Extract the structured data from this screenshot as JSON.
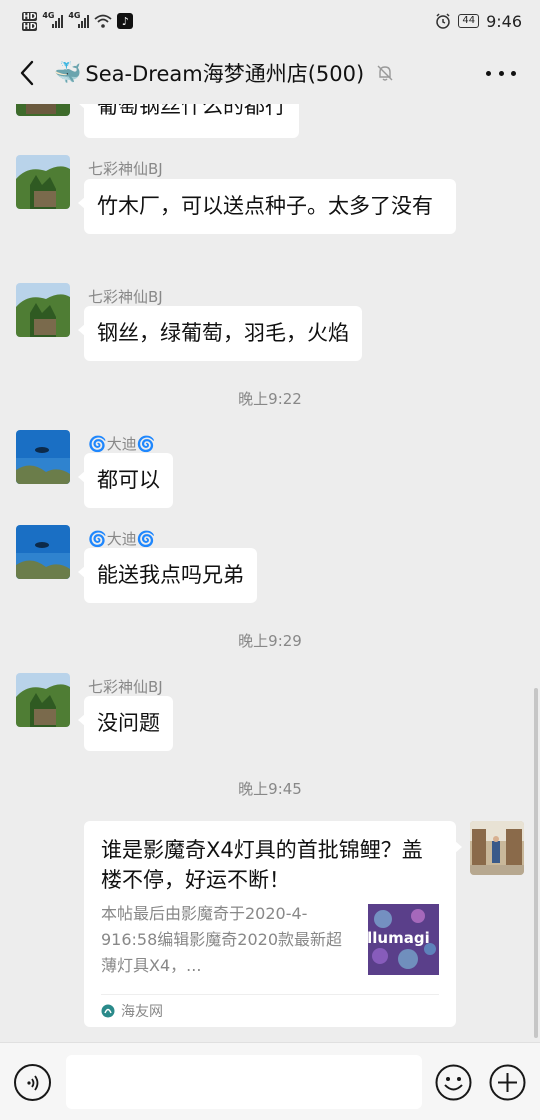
{
  "status_bar": {
    "hd1": "HD",
    "hd2": "HD",
    "net1": "4G",
    "net2": "4G",
    "battery": "44",
    "time": "9:46",
    "tiktok_glyph": "♪"
  },
  "header": {
    "title_emoji": "🐳",
    "title": "Sea-Dream海梦通州店(500)"
  },
  "messages": [
    {
      "text": "葡萄钢丝什么的都行"
    },
    {
      "sender": "七彩神仙BJ",
      "text": "竹木厂，可以送点种子。太多了没有"
    },
    {
      "sender": "七彩神仙BJ",
      "text": "钢丝，绿葡萄，羽毛，火焰"
    },
    {
      "timestamp": "晚上9:22"
    },
    {
      "sender_prefix": "🌀",
      "sender": "大迪",
      "sender_suffix": "🌀",
      "text": "都可以"
    },
    {
      "sender_prefix": "🌀",
      "sender": "大迪",
      "sender_suffix": "🌀",
      "text": "能送我点吗兄弟"
    },
    {
      "timestamp": "晚上9:29"
    },
    {
      "sender": "七彩神仙BJ",
      "text": "没问题"
    },
    {
      "timestamp": "晚上9:45"
    }
  ],
  "link_card": {
    "title": "谁是影魔奇X4灯具的首批锦鲤？盖楼不停，好运不断！",
    "description": "本帖最后由影魔奇于2020-4-916:58编辑影魔奇2020款最新超薄灯具X4，...",
    "thumb_text": "illumagi",
    "source": "海友网"
  },
  "input_bar": {
    "placeholder": ""
  },
  "colors": {
    "background": "#ededed",
    "bubble": "#ffffff",
    "meta_text": "#888888"
  },
  "icons": [
    "back-arrow-icon",
    "mute-bell-icon",
    "more-icon",
    "voice-icon",
    "emoji-icon",
    "plus-icon"
  ]
}
